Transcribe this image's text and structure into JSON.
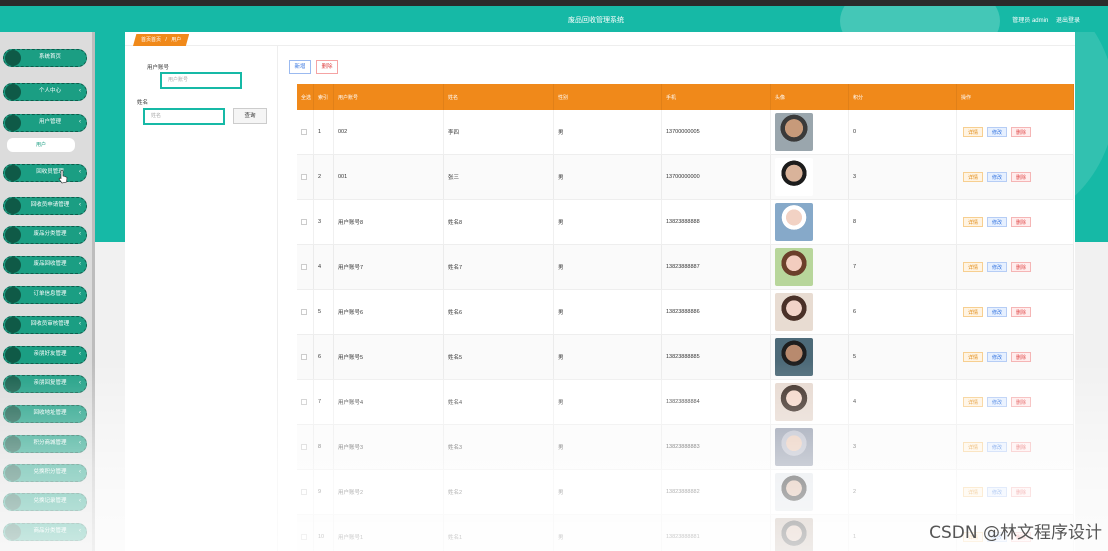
{
  "app": {
    "title": "废品回收管理系统",
    "user_label": "管理员 admin",
    "logout_label": "退出登录"
  },
  "sidebar": {
    "items": [
      {
        "label": "系统首页",
        "expandable": false
      },
      {
        "label": "个人中心",
        "expandable": true
      },
      {
        "label": "用户管理",
        "expandable": true
      },
      {
        "label": "回收员管理",
        "expandable": true
      },
      {
        "label": "回收员申请管理",
        "expandable": true
      },
      {
        "label": "废品分类管理",
        "expandable": true
      },
      {
        "label": "废品回收管理",
        "expandable": true
      },
      {
        "label": "订单信息管理",
        "expandable": true
      },
      {
        "label": "回收员审核管理",
        "expandable": true
      },
      {
        "label": "亲朋好友管理",
        "expandable": true
      },
      {
        "label": "亲朋回复管理",
        "expandable": true
      },
      {
        "label": "回收地址管理",
        "expandable": true
      },
      {
        "label": "积分商城管理",
        "expandable": true
      },
      {
        "label": "兑换积分管理",
        "expandable": true
      },
      {
        "label": "兑换记录管理",
        "expandable": true
      },
      {
        "label": "商品分类管理",
        "expandable": true
      }
    ],
    "sub_item": "用户"
  },
  "breadcrumb": {
    "home": "首页首页",
    "separator": "/",
    "current": "用户"
  },
  "search": {
    "account_label": "用户账号",
    "account_placeholder": "用户账号",
    "name_label": "姓名",
    "name_placeholder": "姓名",
    "button_label": "查询"
  },
  "toolbar": {
    "add_label": "新增",
    "delete_label": "删除"
  },
  "table": {
    "headers": [
      "全选",
      "索引",
      "用户账号",
      "姓名",
      "性别",
      "手机",
      "头像",
      "积分",
      "操作"
    ],
    "rows": [
      {
        "index": "1",
        "account": "002",
        "name": "李四",
        "gender": "男",
        "phone": "13700000005",
        "points": "0",
        "avatar": "avatar-male-1"
      },
      {
        "index": "2",
        "account": "001",
        "name": "张三",
        "gender": "男",
        "phone": "13700000000",
        "points": "3",
        "avatar": "avatar-male-2"
      },
      {
        "index": "3",
        "account": "用户账号8",
        "name": "姓名8",
        "gender": "男",
        "phone": "13823888888",
        "points": "8",
        "avatar": "avatar-female-1"
      },
      {
        "index": "4",
        "account": "用户账号7",
        "name": "姓名7",
        "gender": "男",
        "phone": "13823888887",
        "points": "7",
        "avatar": "avatar-female-2"
      },
      {
        "index": "5",
        "account": "用户账号6",
        "name": "姓名6",
        "gender": "男",
        "phone": "13823888886",
        "points": "6",
        "avatar": "avatar-female-3"
      },
      {
        "index": "6",
        "account": "用户账号5",
        "name": "姓名5",
        "gender": "男",
        "phone": "13823888885",
        "points": "5",
        "avatar": "avatar-male-3"
      },
      {
        "index": "7",
        "account": "用户账号4",
        "name": "姓名4",
        "gender": "男",
        "phone": "13823888884",
        "points": "4",
        "avatar": "avatar-female-4"
      },
      {
        "index": "8",
        "account": "用户账号3",
        "name": "姓名3",
        "gender": "男",
        "phone": "13823888883",
        "points": "3",
        "avatar": "avatar-male-4"
      },
      {
        "index": "9",
        "account": "用户账号2",
        "name": "姓名2",
        "gender": "男",
        "phone": "13823888882",
        "points": "2",
        "avatar": "avatar-male-5"
      },
      {
        "index": "10",
        "account": "用户账号1",
        "name": "姓名1",
        "gender": "男",
        "phone": "13823888881",
        "points": "1",
        "avatar": "avatar-female-5"
      }
    ],
    "actions": {
      "detail": "详情",
      "edit": "修改",
      "delete": "删除"
    }
  },
  "watermark": "CSDN @林文程序设计",
  "colors": {
    "accent": "#16b9a6",
    "header": "#f0891a",
    "menu": "#1b9e83"
  }
}
